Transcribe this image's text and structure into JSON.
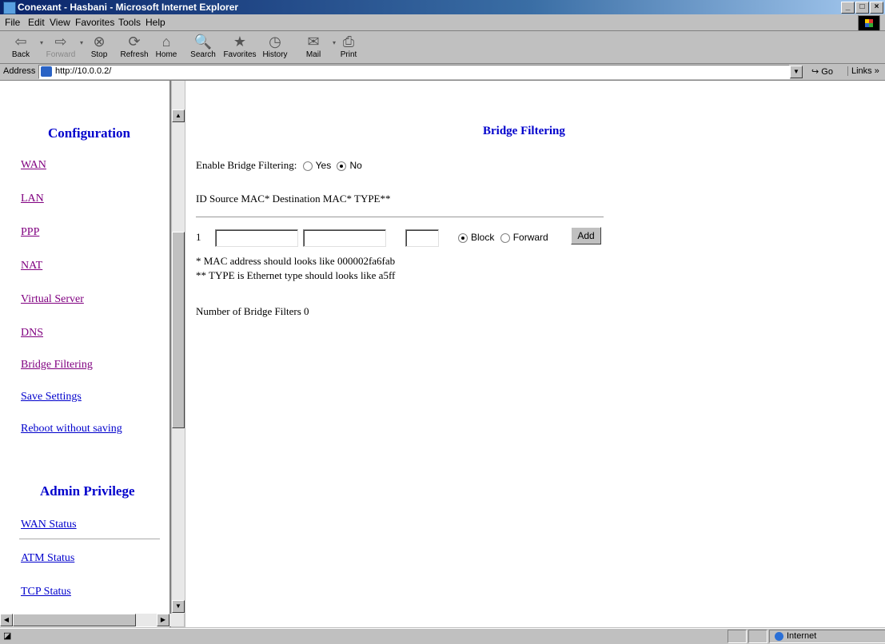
{
  "window": {
    "title": "Conexant - Hasbani - Microsoft Internet Explorer"
  },
  "menu": [
    "File",
    "Edit",
    "View",
    "Favorites",
    "Tools",
    "Help"
  ],
  "toolbar": [
    {
      "label": "Back",
      "icon": "back-arrow-icon",
      "glyph": "⇦",
      "enabled": true
    },
    {
      "label": "Forward",
      "icon": "forward-arrow-icon",
      "glyph": "⇨",
      "enabled": false
    },
    {
      "label": "Stop",
      "icon": "stop-icon",
      "glyph": "⊗",
      "enabled": true
    },
    {
      "label": "Refresh",
      "icon": "refresh-icon",
      "glyph": "⟳",
      "enabled": true
    },
    {
      "label": "Home",
      "icon": "home-icon",
      "glyph": "⌂",
      "enabled": true
    },
    {
      "label": "Search",
      "icon": "search-icon",
      "glyph": "🔍",
      "enabled": true
    },
    {
      "label": "Favorites",
      "icon": "favorites-icon",
      "glyph": "★",
      "enabled": true
    },
    {
      "label": "History",
      "icon": "history-icon",
      "glyph": "◷",
      "enabled": true
    },
    {
      "label": "Mail",
      "icon": "mail-icon",
      "glyph": "✉",
      "enabled": true
    },
    {
      "label": "Print",
      "icon": "print-icon",
      "glyph": "⎙",
      "enabled": true
    }
  ],
  "address": {
    "label": "Address",
    "url": "http://10.0.0.2/",
    "go": "Go",
    "links": "Links »"
  },
  "sidebar": {
    "config_heading": "Configuration",
    "config_links": [
      "WAN",
      "LAN",
      "PPP",
      "NAT",
      "Virtual Server",
      "DNS",
      "Bridge Filtering",
      "Save Settings",
      "Reboot without saving"
    ],
    "admin_heading": "Admin Privilege",
    "admin_links": [
      "WAN Status",
      "ATM Status",
      "TCP Status"
    ]
  },
  "main": {
    "heading": "Bridge Filtering",
    "enable_label": "Enable Bridge Filtering:",
    "yes": "Yes",
    "no": "No",
    "enable_selected": "No",
    "columns": "ID Source MAC*  Destination MAC* TYPE**",
    "row_id": "1",
    "source_mac": "",
    "dest_mac": "",
    "type": "",
    "block": "Block",
    "forward": "Forward",
    "action_selected": "Block",
    "add": "Add",
    "note1": "* MAC address should looks like 000002fa6fab",
    "note2": "** TYPE is Ethernet type should looks like a5ff",
    "count_label": "Number of Bridge Filters 0"
  },
  "status": {
    "zone": "Internet"
  }
}
